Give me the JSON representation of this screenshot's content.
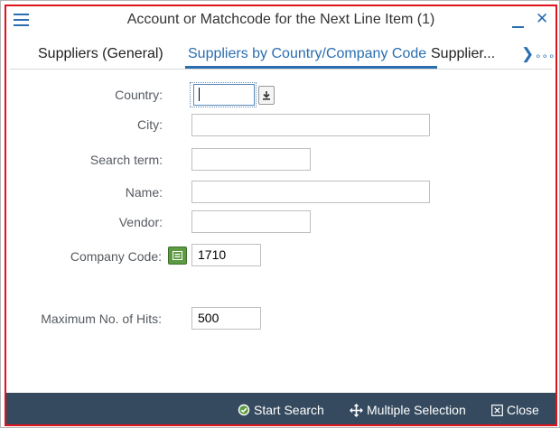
{
  "dialog": {
    "title": "Account or Matchcode for the Next Line Item (1)"
  },
  "tabs": [
    {
      "label": "Suppliers (General)",
      "active": false
    },
    {
      "label": "Suppliers by Country/Company Code",
      "active": true
    },
    {
      "label": "Supplier...",
      "active": false
    }
  ],
  "tab_overflow": "∘∘∘",
  "form": {
    "country": {
      "label": "Country:",
      "value": ""
    },
    "city": {
      "label": "City:",
      "value": ""
    },
    "search_term": {
      "label": "Search term:",
      "value": ""
    },
    "name": {
      "label": "Name:",
      "value": ""
    },
    "vendor": {
      "label": "Vendor:",
      "value": ""
    },
    "company_code": {
      "label": "Company Code:",
      "value": "1710"
    },
    "max_hits": {
      "label": "Maximum No. of Hits:",
      "value": "500"
    }
  },
  "footer": {
    "start_search": "Start Search",
    "multiple_selection": "Multiple Selection",
    "close": "Close"
  },
  "colors": {
    "accent": "#2a6eb0",
    "footer_bg": "#354a5f",
    "focus_frame": "#e0121b",
    "equals_button": "#5d9b43"
  }
}
